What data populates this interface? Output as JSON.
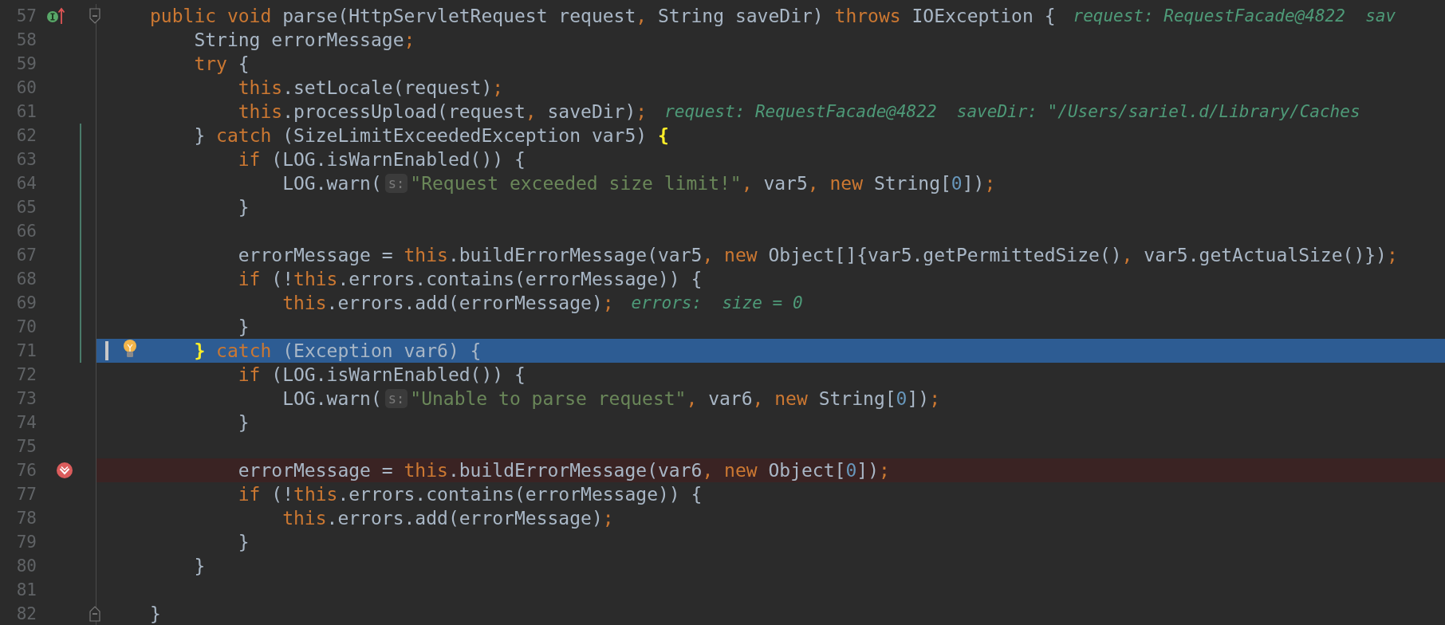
{
  "editor": {
    "lines": [
      {
        "number": "57",
        "implements": true,
        "breakpoint": false,
        "fold_start": true,
        "fold_end": false,
        "changed": false,
        "current": false,
        "segments": [
          {
            "kind": "code",
            "tokens": [
              {
                "kind": "keyword",
                "text": "public void "
              },
              {
                "kind": "plain",
                "text": "parse(HttpServletRequest request"
              },
              {
                "kind": "punct",
                "text": ", "
              },
              {
                "kind": "plain",
                "text": "String saveDir) "
              },
              {
                "kind": "keyword",
                "text": "throws "
              },
              {
                "kind": "plain",
                "text": "IOException {"
              }
            ]
          },
          {
            "kind": "debug",
            "text": "request: RequestFacade@4822  sav"
          }
        ]
      },
      {
        "number": "58",
        "implements": false,
        "breakpoint": false,
        "fold_start": false,
        "fold_end": false,
        "changed": false,
        "current": false,
        "segments": [
          {
            "kind": "code",
            "tokens": [
              {
                "kind": "plain",
                "text": "    String errorMessage"
              },
              {
                "kind": "punct",
                "text": ";"
              }
            ]
          }
        ]
      },
      {
        "number": "59",
        "implements": false,
        "breakpoint": false,
        "fold_start": false,
        "fold_end": false,
        "changed": false,
        "current": false,
        "segments": [
          {
            "kind": "code",
            "tokens": [
              {
                "kind": "keyword",
                "text": "    try"
              },
              {
                "kind": "plain",
                "text": " {"
              }
            ]
          }
        ]
      },
      {
        "number": "60",
        "implements": false,
        "breakpoint": false,
        "fold_start": false,
        "fold_end": false,
        "changed": false,
        "current": false,
        "segments": [
          {
            "kind": "code",
            "tokens": [
              {
                "kind": "keyword",
                "text": "        this"
              },
              {
                "kind": "plain",
                "text": ".setLocale(request)"
              },
              {
                "kind": "punct",
                "text": ";"
              }
            ]
          }
        ]
      },
      {
        "number": "61",
        "implements": false,
        "breakpoint": false,
        "fold_start": false,
        "fold_end": false,
        "changed": false,
        "current": false,
        "segments": [
          {
            "kind": "code",
            "tokens": [
              {
                "kind": "keyword",
                "text": "        this"
              },
              {
                "kind": "plain",
                "text": ".processUpload(request"
              },
              {
                "kind": "punct",
                "text": ", "
              },
              {
                "kind": "plain",
                "text": "saveDir)"
              },
              {
                "kind": "punct",
                "text": ";"
              }
            ]
          },
          {
            "kind": "debug",
            "text": "request: RequestFacade@4822  saveDir: \"/Users/sariel.d/Library/Caches"
          }
        ]
      },
      {
        "number": "62",
        "implements": false,
        "breakpoint": false,
        "fold_start": false,
        "fold_end": false,
        "changed": true,
        "current": false,
        "segments": [
          {
            "kind": "code",
            "tokens": [
              {
                "kind": "plain",
                "text": "    } "
              },
              {
                "kind": "keyword",
                "text": "catch"
              },
              {
                "kind": "plain",
                "text": " (SizeLimitExceededException var5) "
              },
              {
                "kind": "match",
                "text": "{"
              }
            ]
          }
        ]
      },
      {
        "number": "63",
        "implements": false,
        "breakpoint": false,
        "fold_start": false,
        "fold_end": false,
        "changed": true,
        "current": false,
        "segments": [
          {
            "kind": "code",
            "tokens": [
              {
                "kind": "keyword",
                "text": "        if"
              },
              {
                "kind": "plain",
                "text": " (LOG.isWarnEnabled()) {"
              }
            ]
          }
        ]
      },
      {
        "number": "64",
        "implements": false,
        "breakpoint": false,
        "fold_start": false,
        "fold_end": false,
        "changed": true,
        "current": false,
        "segments": [
          {
            "kind": "code",
            "tokens": [
              {
                "kind": "plain",
                "text": "            LOG.warn("
              }
            ]
          },
          {
            "kind": "hint",
            "text": "s:"
          },
          {
            "kind": "code",
            "tokens": [
              {
                "kind": "string",
                "text": "\"Request exceeded size limit!\""
              },
              {
                "kind": "punct",
                "text": ", "
              },
              {
                "kind": "plain",
                "text": "var5"
              },
              {
                "kind": "punct",
                "text": ", "
              },
              {
                "kind": "keyword",
                "text": "new "
              },
              {
                "kind": "plain",
                "text": "String["
              },
              {
                "kind": "number",
                "text": "0"
              },
              {
                "kind": "plain",
                "text": "])"
              },
              {
                "kind": "punct",
                "text": ";"
              }
            ]
          }
        ]
      },
      {
        "number": "65",
        "implements": false,
        "breakpoint": false,
        "fold_start": false,
        "fold_end": false,
        "changed": true,
        "current": false,
        "segments": [
          {
            "kind": "code",
            "tokens": [
              {
                "kind": "plain",
                "text": "        }"
              }
            ]
          }
        ]
      },
      {
        "number": "66",
        "implements": false,
        "breakpoint": false,
        "fold_start": false,
        "fold_end": false,
        "changed": true,
        "current": false
      },
      {
        "number": "67",
        "implements": false,
        "breakpoint": false,
        "fold_start": false,
        "fold_end": false,
        "changed": true,
        "current": false,
        "segments": [
          {
            "kind": "code",
            "tokens": [
              {
                "kind": "plain",
                "text": "        errorMessage = "
              },
              {
                "kind": "keyword",
                "text": "this"
              },
              {
                "kind": "plain",
                "text": ".buildErrorMessage(var5"
              },
              {
                "kind": "punct",
                "text": ", "
              },
              {
                "kind": "keyword",
                "text": "new "
              },
              {
                "kind": "plain",
                "text": "Object[]{var5.getPermittedSize()"
              },
              {
                "kind": "punct",
                "text": ", "
              },
              {
                "kind": "plain",
                "text": "var5.getActualSize()})"
              },
              {
                "kind": "punct",
                "text": ";"
              }
            ]
          }
        ]
      },
      {
        "number": "68",
        "implements": false,
        "breakpoint": false,
        "fold_start": false,
        "fold_end": false,
        "changed": true,
        "current": false,
        "segments": [
          {
            "kind": "code",
            "tokens": [
              {
                "kind": "keyword",
                "text": "        if"
              },
              {
                "kind": "plain",
                "text": " (!"
              },
              {
                "kind": "keyword",
                "text": "this"
              },
              {
                "kind": "plain",
                "text": ".errors.contains(errorMessage)) {"
              }
            ]
          }
        ]
      },
      {
        "number": "69",
        "implements": false,
        "breakpoint": false,
        "fold_start": false,
        "fold_end": false,
        "changed": true,
        "current": false,
        "segments": [
          {
            "kind": "code",
            "tokens": [
              {
                "kind": "keyword",
                "text": "            this"
              },
              {
                "kind": "plain",
                "text": ".errors.add(errorMessage)"
              },
              {
                "kind": "punct",
                "text": ";"
              }
            ]
          },
          {
            "kind": "debug",
            "text": "errors:  size = 0"
          }
        ]
      },
      {
        "number": "70",
        "implements": false,
        "breakpoint": false,
        "fold_start": false,
        "fold_end": false,
        "changed": true,
        "current": false,
        "segments": [
          {
            "kind": "code",
            "tokens": [
              {
                "kind": "plain",
                "text": "        }"
              }
            ]
          }
        ]
      },
      {
        "number": "71",
        "implements": false,
        "breakpoint": false,
        "fold_start": false,
        "fold_end": false,
        "changed": true,
        "current": true,
        "segments": [
          {
            "kind": "code",
            "tokens": [
              {
                "kind": "match",
                "text": "    }"
              },
              {
                "kind": "keyword",
                "text": " catch"
              },
              {
                "kind": "plain",
                "text": " (Exception var6) {"
              }
            ]
          }
        ]
      },
      {
        "number": "72",
        "implements": false,
        "breakpoint": false,
        "fold_start": false,
        "fold_end": false,
        "changed": false,
        "current": false,
        "segments": [
          {
            "kind": "code",
            "tokens": [
              {
                "kind": "keyword",
                "text": "        if"
              },
              {
                "kind": "plain",
                "text": " (LOG.isWarnEnabled()) {"
              }
            ]
          }
        ]
      },
      {
        "number": "73",
        "implements": false,
        "breakpoint": false,
        "fold_start": false,
        "fold_end": false,
        "changed": false,
        "current": false,
        "segments": [
          {
            "kind": "code",
            "tokens": [
              {
                "kind": "plain",
                "text": "            LOG.warn("
              }
            ]
          },
          {
            "kind": "hint",
            "text": "s:"
          },
          {
            "kind": "code",
            "tokens": [
              {
                "kind": "string",
                "text": "\"Unable to parse request\""
              },
              {
                "kind": "punct",
                "text": ", "
              },
              {
                "kind": "plain",
                "text": "var6"
              },
              {
                "kind": "punct",
                "text": ", "
              },
              {
                "kind": "keyword",
                "text": "new "
              },
              {
                "kind": "plain",
                "text": "String["
              },
              {
                "kind": "number",
                "text": "0"
              },
              {
                "kind": "plain",
                "text": "])"
              },
              {
                "kind": "punct",
                "text": ";"
              }
            ]
          }
        ]
      },
      {
        "number": "74",
        "implements": false,
        "breakpoint": false,
        "fold_start": false,
        "fold_end": false,
        "changed": false,
        "current": false,
        "segments": [
          {
            "kind": "code",
            "tokens": [
              {
                "kind": "plain",
                "text": "        }"
              }
            ]
          }
        ]
      },
      {
        "number": "75",
        "implements": false,
        "breakpoint": false,
        "fold_start": false,
        "fold_end": false,
        "changed": false,
        "current": false
      },
      {
        "number": "76",
        "implements": false,
        "breakpoint": true,
        "fold_start": false,
        "fold_end": false,
        "changed": false,
        "current": false,
        "segments": [
          {
            "kind": "code",
            "tokens": [
              {
                "kind": "plain",
                "text": "        errorMessage = "
              },
              {
                "kind": "keyword",
                "text": "this"
              },
              {
                "kind": "plain",
                "text": ".buildErrorMessage(var6"
              },
              {
                "kind": "punct",
                "text": ", "
              },
              {
                "kind": "keyword",
                "text": "new "
              },
              {
                "kind": "plain",
                "text": "Object["
              },
              {
                "kind": "number",
                "text": "0"
              },
              {
                "kind": "plain",
                "text": "])"
              },
              {
                "kind": "punct",
                "text": ";"
              }
            ]
          }
        ]
      },
      {
        "number": "77",
        "implements": false,
        "breakpoint": false,
        "fold_start": false,
        "fold_end": false,
        "changed": false,
        "current": false,
        "segments": [
          {
            "kind": "code",
            "tokens": [
              {
                "kind": "keyword",
                "text": "        if"
              },
              {
                "kind": "plain",
                "text": " (!"
              },
              {
                "kind": "keyword",
                "text": "this"
              },
              {
                "kind": "plain",
                "text": ".errors.contains(errorMessage)) {"
              }
            ]
          }
        ]
      },
      {
        "number": "78",
        "implements": false,
        "breakpoint": false,
        "fold_start": false,
        "fold_end": false,
        "changed": false,
        "current": false,
        "segments": [
          {
            "kind": "code",
            "tokens": [
              {
                "kind": "keyword",
                "text": "            this"
              },
              {
                "kind": "plain",
                "text": ".errors.add(errorMessage)"
              },
              {
                "kind": "punct",
                "text": ";"
              }
            ]
          }
        ]
      },
      {
        "number": "79",
        "implements": false,
        "breakpoint": false,
        "fold_start": false,
        "fold_end": false,
        "changed": false,
        "current": false,
        "segments": [
          {
            "kind": "code",
            "tokens": [
              {
                "kind": "plain",
                "text": "        }"
              }
            ]
          }
        ]
      },
      {
        "number": "80",
        "implements": false,
        "breakpoint": false,
        "fold_start": false,
        "fold_end": false,
        "changed": false,
        "current": false,
        "segments": [
          {
            "kind": "code",
            "tokens": [
              {
                "kind": "plain",
                "text": "    }"
              }
            ]
          }
        ]
      },
      {
        "number": "81",
        "implements": false,
        "breakpoint": false,
        "fold_start": false,
        "fold_end": false,
        "changed": false,
        "current": false
      },
      {
        "number": "82",
        "implements": false,
        "breakpoint": false,
        "fold_start": false,
        "fold_end": true,
        "changed": false,
        "current": false,
        "segments": [
          {
            "kind": "code",
            "tokens": [
              {
                "kind": "plain",
                "text": "}"
              }
            ]
          }
        ]
      }
    ]
  }
}
